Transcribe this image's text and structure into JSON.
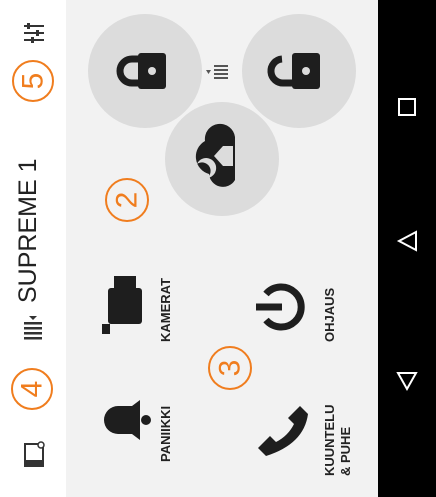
{
  "header": {
    "title": "SUPREME 1",
    "icons": [
      "settings-sliders-icon",
      "list-switch-icon",
      "device-screen-icon"
    ]
  },
  "badges": [
    "5",
    "4",
    "2",
    "3"
  ],
  "tiles": [
    {
      "label": "KAMERAT",
      "icon": "camera-icon"
    },
    {
      "label": "PANIIKKI",
      "icon": "bell-icon"
    },
    {
      "label": "OHJAUS",
      "icon": "power-icon"
    },
    {
      "label": "KUUNTELU",
      "label2": "& PUHE",
      "icon": "phone-icon"
    }
  ],
  "controls": [
    "lock-closed-button",
    "lock-open-button",
    "night-home-mode-button"
  ],
  "colors": {
    "accent": "#f07d1e",
    "circle": "#dcdcdc",
    "icon": "#1e1e1e",
    "navbar": "#000000"
  }
}
